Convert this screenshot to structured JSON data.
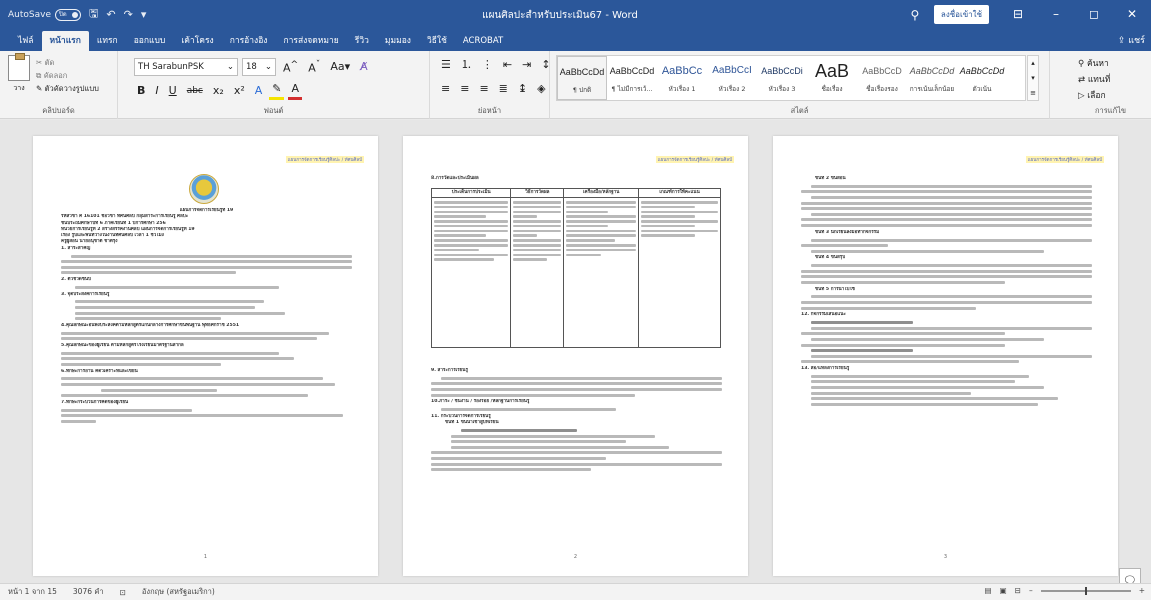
{
  "titlebar": {
    "autosave_label": "AutoSave",
    "autosave_state": "ปิด",
    "doc_title": "แผนศิลปะสำหรับประเมิน67 - Word",
    "signin": "ลงชื่อเข้าใช้"
  },
  "menu": {
    "tabs": [
      "ไฟล์",
      "หน้าแรก",
      "แทรก",
      "ออกแบบ",
      "เค้าโครง",
      "การอ้างอิง",
      "การส่งจดหมาย",
      "รีวิว",
      "มุมมอง",
      "วิธีใช้",
      "ACROBAT"
    ],
    "share": "แชร์"
  },
  "ribbon": {
    "clipboard": {
      "paste": "วาง",
      "cut": "ตัด",
      "copy": "คัดลอก",
      "format_painter": "ตัวคัดวางรูปแบบ",
      "label": "คลิปบอร์ด"
    },
    "font": {
      "family": "TH SarabunPSK",
      "size": "18",
      "label": "ฟอนต์"
    },
    "paragraph_label": "ย่อหน้า",
    "styles": {
      "label": "สไตล์",
      "items": [
        {
          "sample": "AaBbCcDd",
          "name": "¶ ปกติ"
        },
        {
          "sample": "AaBbCcDd",
          "name": "¶ ไม่มีการเว้..."
        },
        {
          "sample": "AaBbCc",
          "name": "หัวเรื่อง 1"
        },
        {
          "sample": "AaBbCcI",
          "name": "หัวเรื่อง 2"
        },
        {
          "sample": "AaBbCcDi",
          "name": "หัวเรื่อง 3"
        },
        {
          "sample": "AaB",
          "name": "ชื่อเรื่อง"
        },
        {
          "sample": "AaBbCcD",
          "name": "ชื่อเรื่องรอง"
        },
        {
          "sample": "AaBbCcDd",
          "name": "การเน้นเล็กน้อย"
        },
        {
          "sample": "AaBbCcDd",
          "name": "ตัวเน้น"
        }
      ]
    },
    "editing": {
      "find": "ค้นหา",
      "replace": "แทนที่",
      "select": "เลือก",
      "label": "การแก้ไข"
    }
  },
  "pages": {
    "header_text": "แผนการจัดการเรียนรู้ศิลปะ / ทัศนศิลป์",
    "page1": {
      "lines": [
        "แผนการจัดการเรียนรู้ที่ 19",
        "รหัสวิชา ศ 16101          ชื่อวิชา ทัศนศิลป์          กลุ่มสาระการเรียนรู้ ศิลปะ",
        "ชั้นประถมศึกษาปีที่ 6                                        ภาคเรียนที่ 1 ปีการศึกษา 256",
        "หน่วยการเรียนรู้ที่ 2 สร้างสรรค์งานศิลป์                  แผนการจัดการเรียนรู้ที่ 19",
        "เรื่อง รูปและพื้นที่ว่างในงานทัศนศิลป์          เวลา 1 ชั่วโมง",
        "ครูผู้สอน นายอนุชาติ  ชาติรุ่ง",
        "1. สาระสำคัญ",
        "2. ตัวชี้วัดชั้นปี",
        "3. จุดประสงค์การเรียนรู้",
        "4.คุณลักษณะอันพึงประสงค์ตามหลักสูตรแกนกลางการศึกษาขั้นพื้นฐาน พุทธศักราช 2551",
        "5.คุณลักษณะของผู้เรียน ตามหลักสูตรโรงเรียนมาตรฐานสากล",
        "6.ทักษะการอ่าน คิดวิเคราะห์และเขียน",
        "7.ทักษะกระบวนการคิดของผู้เรียน"
      ],
      "num": "1"
    },
    "page2": {
      "section8": "8.การวัดและประเมินผล",
      "table_headers": [
        "ประเด็นการประเมิน",
        "วิธีการวัดผล",
        "เครื่องมือ/หลักฐาน",
        "เกณฑ์การให้คะแนน"
      ],
      "section9": "9. สาระการเรียนรู้",
      "section10": "10.ภาระ / ชิ้นงาน / ร่องรอย /หลักฐานการเรียนรู้",
      "section11": "11. กระบวนการจัดการเรียนรู้",
      "step1": "ขั้นที่ 1 ขั้นนำเข้าสู่บทเรียน",
      "num": "2"
    },
    "page3": {
      "step2": "ขั้นที่ 2 ขั้นสอน",
      "step3": "ขั้นที่ 3 นักเรียนลงมือทำกิจกรรม",
      "step4": "ขั้นที่ 4 ขั้นสรุป",
      "step5": "ขั้นที่ 5 การนำไปใช้",
      "section12": "12. กิจกรรมเสนอแนะ",
      "section13": "13. สื่อ/แหล่งการเรียนรู้",
      "num": "3"
    }
  },
  "statusbar": {
    "page": "หน้า 1 จาก 15",
    "words": "3076 คำ",
    "language": "อังกฤษ (สหรัฐอเมริกา)"
  }
}
